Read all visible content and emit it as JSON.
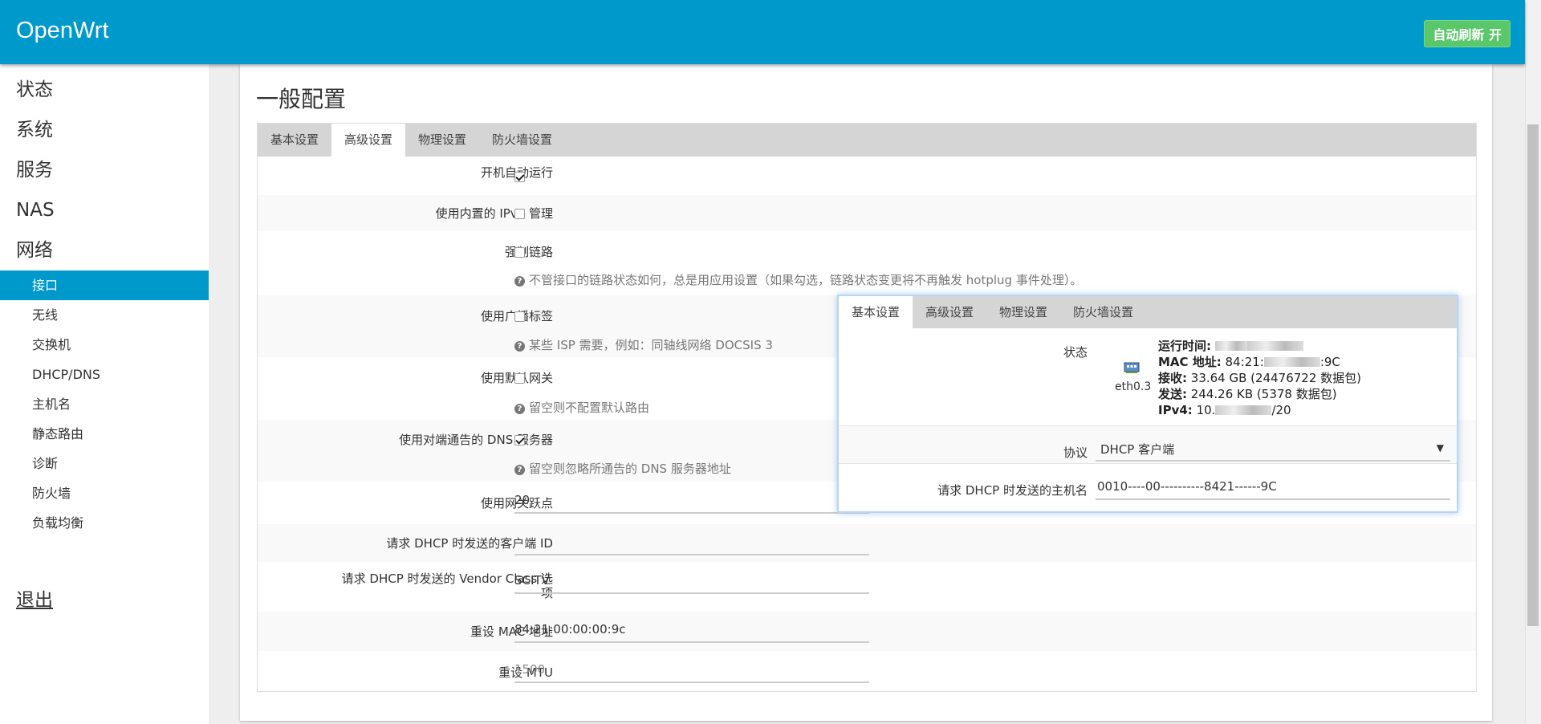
{
  "header": {
    "brand": "OpenWrt",
    "refresh_label": "自动刷新 开"
  },
  "sidebar": {
    "top_items": [
      "状态",
      "系统",
      "服务",
      "NAS",
      "网络"
    ],
    "sub_items": [
      "接口",
      "无线",
      "交换机",
      "DHCP/DNS",
      "主机名",
      "静态路由",
      "诊断",
      "防火墙",
      "负载均衡"
    ],
    "active_sub": "接口",
    "logout": "退出"
  },
  "page": {
    "title": "一般配置"
  },
  "tabs": [
    "基本设置",
    "高级设置",
    "物理设置",
    "防火墙设置"
  ],
  "active_tab": "高级设置",
  "form": {
    "autostart": {
      "label": "开机自动运行",
      "checked": true
    },
    "ipv6": {
      "label": "使用内置的 IPv6 管理",
      "checked": false
    },
    "force_link": {
      "label": "强制链路",
      "checked": false,
      "hint": "不管接口的链路状态如何，总是用应用设置（如果勾选，链路状态变更将不再触发 hotplug 事件处理）。"
    },
    "broadcast": {
      "label": "使用广播标签",
      "checked": false,
      "hint": "某些 ISP 需要，例如：同轴线网络 DOCSIS 3"
    },
    "default_gw": {
      "label": "使用默认网关",
      "checked": false,
      "hint": "留空则不配置默认路由"
    },
    "peer_dns": {
      "label": "使用对端通告的 DNS 服务器",
      "checked": true,
      "hint": "留空则忽略所通告的 DNS 服务器地址"
    },
    "gw_metric": {
      "label": "使用网关跃点",
      "value": "20"
    },
    "client_id": {
      "label": "请求 DHCP 时发送的客户端 ID",
      "value": ""
    },
    "vendor_class": {
      "label_line1": "请求 DHCP 时发送的 Vendor Class 选",
      "label_line2": "项",
      "value": "SCITV"
    },
    "mac_override": {
      "label": "重设 MAC 地址",
      "value": "84:21:00:00:00:9c"
    },
    "mtu": {
      "label": "重设 MTU",
      "placeholder": "1500"
    }
  },
  "popup": {
    "tabs": [
      "基本设置",
      "高级设置",
      "物理设置",
      "防火墙设置"
    ],
    "active_tab": "基本设置",
    "status_label": "状态",
    "iface_name": "eth0.3",
    "uptime_label": "运行时间:",
    "mac_label": "MAC 地址:",
    "mac_prefix": "84:21:",
    "mac_suffix": ":9C",
    "rx_label": "接收:",
    "rx_value": "33.64 GB (24476722 数据包)",
    "tx_label": "发送:",
    "tx_value": "244.26 KB (5378 数据包)",
    "ipv4_label": "IPv4:",
    "ipv4_prefix": "10.",
    "ipv4_suffix": "/20",
    "protocol_label": "协议",
    "protocol_value": "DHCP 客户端",
    "hostname_label": "请求 DHCP 时发送的主机名",
    "hostname_value": "0010----00----------8421------9C"
  }
}
